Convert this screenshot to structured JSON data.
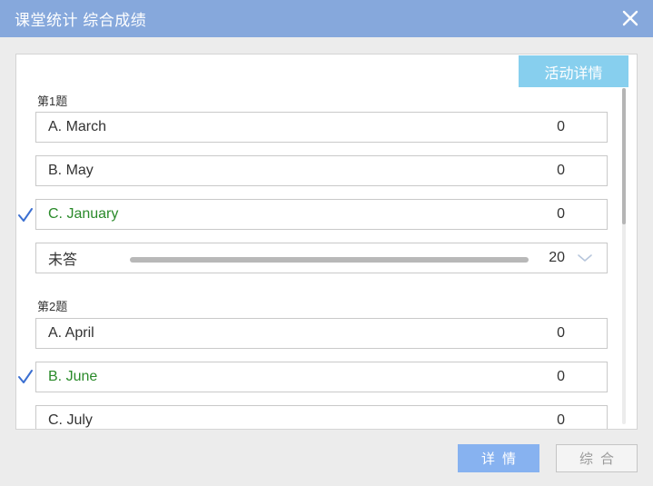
{
  "window": {
    "title": "课堂统计 综合成绩",
    "close_icon": "close-icon"
  },
  "toolbar": {
    "activity_details_label": "活动详情"
  },
  "colors": {
    "titlebar": "#86a8dc",
    "correct_text": "#2a8a2a",
    "check_mark": "#3b6fd1",
    "primary_button": "#87b2f0",
    "activity_button": "#87cfee"
  },
  "questions": [
    {
      "label": "第1题",
      "options": [
        {
          "text": "A. March",
          "count": "0",
          "correct": false
        },
        {
          "text": "B. May",
          "count": "0",
          "correct": false
        },
        {
          "text": "C. January",
          "count": "0",
          "correct": true
        }
      ],
      "unanswered": {
        "label": "未答",
        "count": "20",
        "fill_fraction": 1.0
      }
    },
    {
      "label": "第2题",
      "options": [
        {
          "text": "A. April",
          "count": "0",
          "correct": false
        },
        {
          "text": "B. June",
          "count": "0",
          "correct": true
        },
        {
          "text": "C. July",
          "count": "0",
          "correct": false
        }
      ]
    }
  ],
  "footer": {
    "detail_label": "详情",
    "summary_label": "综合"
  }
}
